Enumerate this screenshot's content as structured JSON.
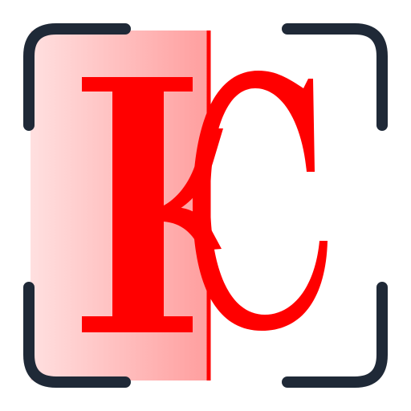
{
  "logo": {
    "lettering": "KC",
    "colors": {
      "accent": "#ff0000",
      "frame": "#1f2937",
      "gradient_start": "#ffe0e0",
      "gradient_end": "#ff9e9e",
      "background": "#ffffff"
    },
    "icons": [
      "viewfinder-frame-icon",
      "kc-monogram-icon",
      "scan-line-icon"
    ]
  }
}
